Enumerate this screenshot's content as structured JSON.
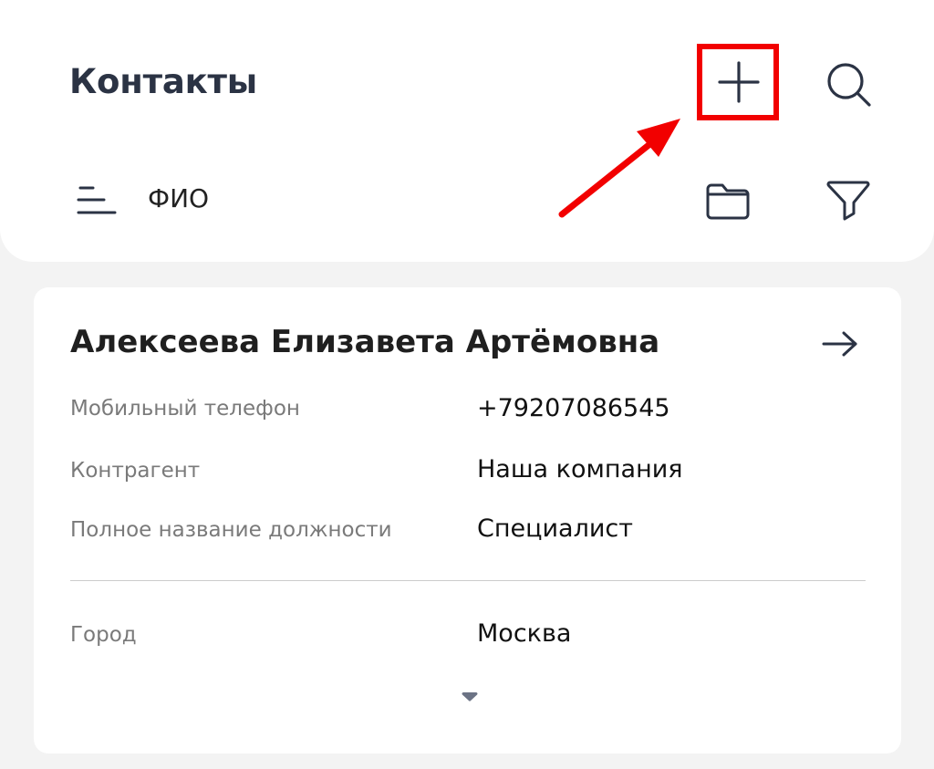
{
  "header": {
    "title": "Контакты",
    "sort_label": "ФИО",
    "icons": {
      "add": "plus-icon",
      "search": "search-icon",
      "sort": "sort-lines-icon",
      "folder": "folder-icon",
      "filter": "filter-icon"
    },
    "highlight_color": "#f20000"
  },
  "contact": {
    "name": "Алексеева Елизавета Артёмовна",
    "fields": [
      {
        "label": "Мобильный телефон",
        "value": "+79207086545"
      },
      {
        "label": "Контрагент",
        "value": "Наша компания"
      },
      {
        "label": "Полное название должности",
        "value": "Специалист"
      },
      {
        "label": "Город",
        "value": "Москва"
      }
    ],
    "icons": {
      "open": "arrow-right-icon",
      "expand": "caret-down-icon"
    }
  },
  "colors": {
    "title": "#2b3344",
    "background": "#f3f3f3",
    "card": "#ffffff",
    "label": "#7a7a7a",
    "accent_annotation": "#f20000"
  }
}
